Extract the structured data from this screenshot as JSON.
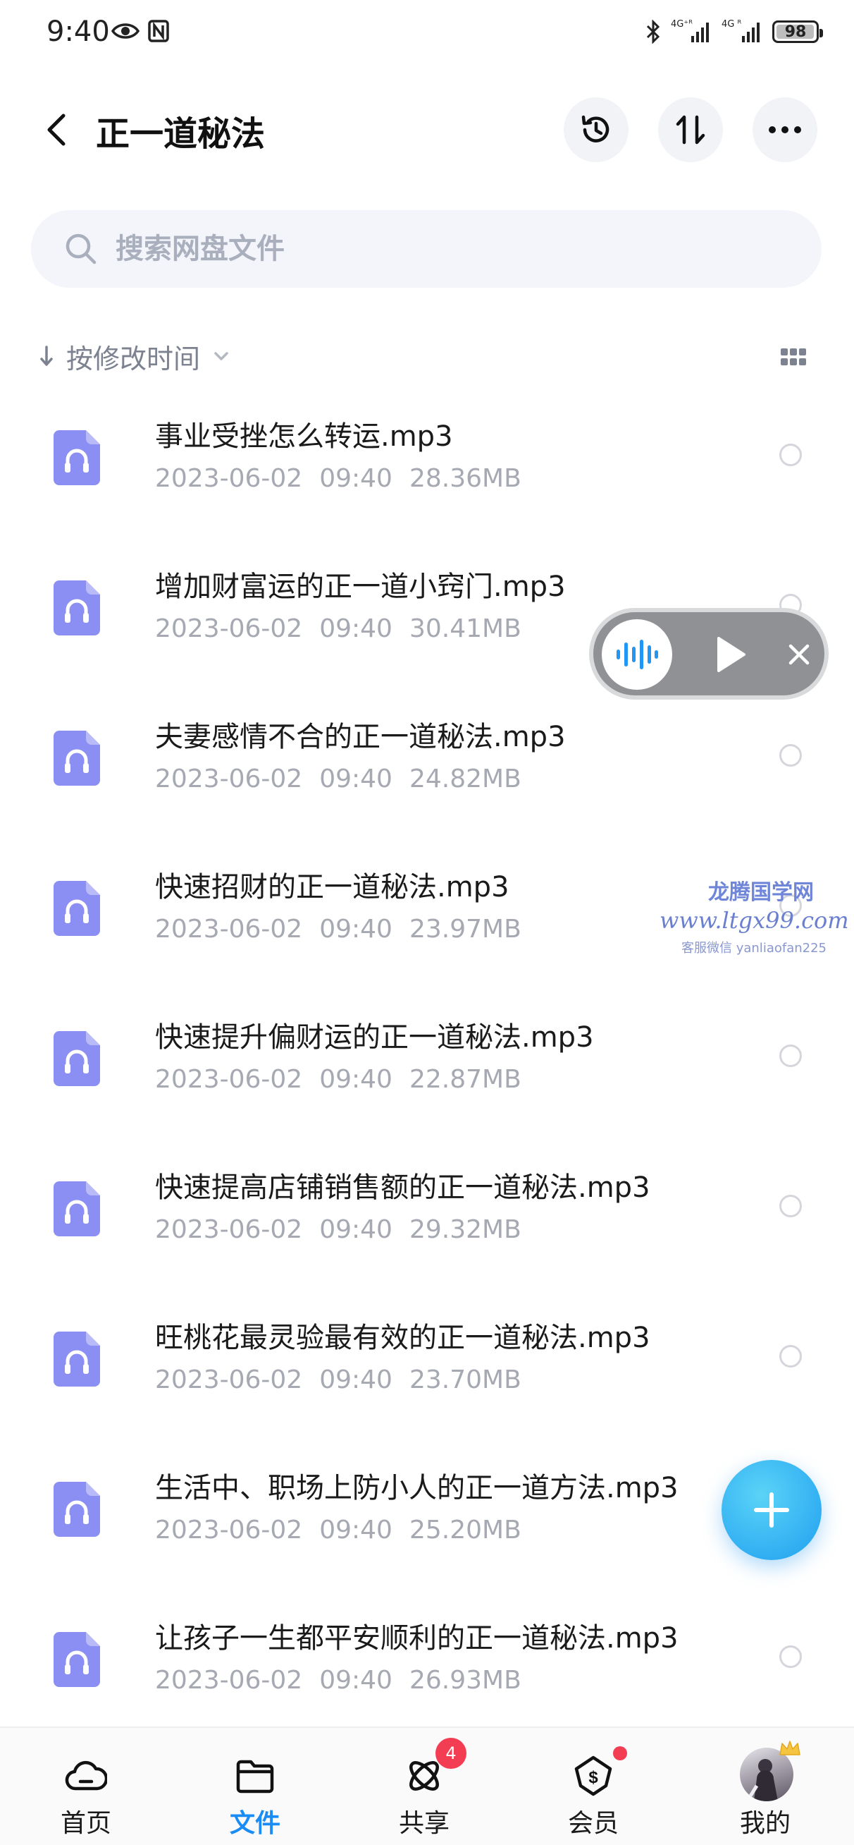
{
  "status_bar": {
    "time": "9:40",
    "net1": "4G⁺ᴿ",
    "net2": "4G ᴿ",
    "battery": "98",
    "battery_level": 0.98
  },
  "header": {
    "title": "正一道秘法"
  },
  "search": {
    "placeholder": "搜索网盘文件"
  },
  "sort": {
    "label": "按修改时间"
  },
  "files": [
    {
      "name": "事业受挫怎么转运.mp3",
      "date": "2023-06-02",
      "time": "09:40",
      "size": "28.36MB"
    },
    {
      "name": "增加财富运的正一道小窍门.mp3",
      "date": "2023-06-02",
      "time": "09:40",
      "size": "30.41MB"
    },
    {
      "name": "夫妻感情不合的正一道秘法.mp3",
      "date": "2023-06-02",
      "time": "09:40",
      "size": "24.82MB"
    },
    {
      "name": "快速招财的正一道秘法.mp3",
      "date": "2023-06-02",
      "time": "09:40",
      "size": "23.97MB"
    },
    {
      "name": "快速提升偏财运的正一道秘法.mp3",
      "date": "2023-06-02",
      "time": "09:40",
      "size": "22.87MB"
    },
    {
      "name": "快速提高店铺销售额的正一道秘法.mp3",
      "date": "2023-06-02",
      "time": "09:40",
      "size": "29.32MB"
    },
    {
      "name": "旺桃花最灵验最有效的正一道秘法.mp3",
      "date": "2023-06-02",
      "time": "09:40",
      "size": "23.70MB"
    },
    {
      "name": "生活中、职场上防小人的正一道方法.mp3",
      "date": "2023-06-02",
      "time": "09:40",
      "size": "25.20MB"
    },
    {
      "name": "让孩子一生都平安顺利的正一道秘法.mp3",
      "date": "2023-06-02",
      "time": "09:40",
      "size": "26.93MB"
    }
  ],
  "watermark": {
    "title": "龙腾国学网",
    "url": "www.ltgx99.com",
    "contact": "客服微信 yanliaofan225"
  },
  "nav": {
    "items": [
      {
        "label": "首页"
      },
      {
        "label": "文件"
      },
      {
        "label": "共享",
        "badge": "4"
      },
      {
        "label": "会员"
      },
      {
        "label": "我的"
      }
    ]
  },
  "colors": {
    "accent": "#1a8cf5",
    "file_icon": "#8b8ef2",
    "badge": "#f33d52"
  },
  "icons": {
    "header": [
      "back-arrow-icon",
      "history-icon",
      "sort-swap-icon",
      "more-icon"
    ],
    "file": "audio-headphone-file-icon",
    "fab": "plus-icon"
  }
}
